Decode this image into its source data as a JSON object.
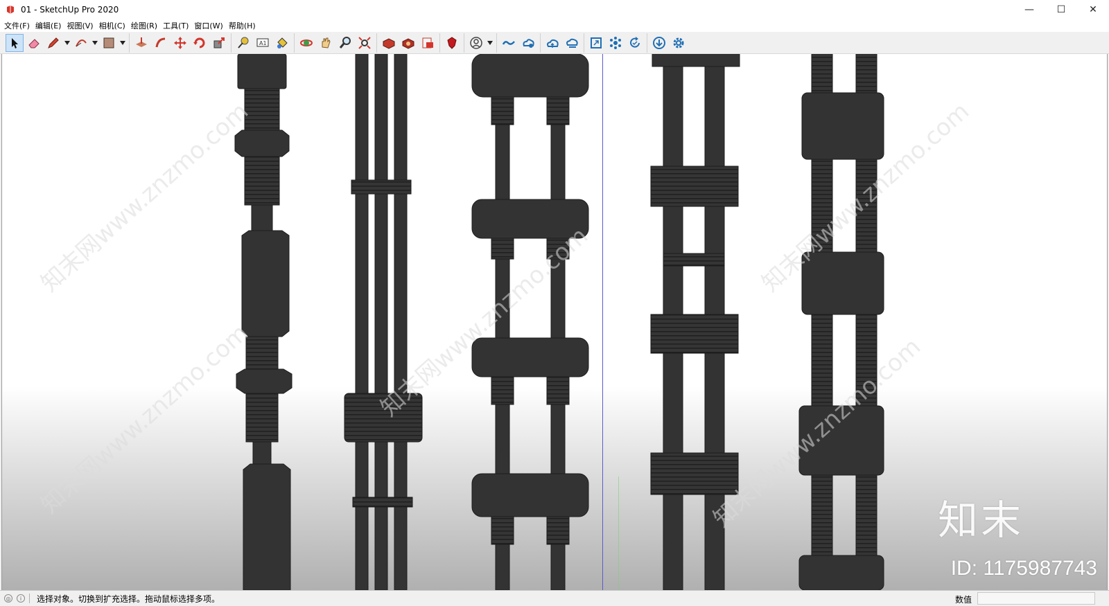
{
  "window": {
    "title": "01 - SketchUp Pro 2020",
    "minimize_glyph": "—",
    "maximize_glyph": "☐",
    "close_glyph": "✕"
  },
  "menu": [
    "文件(F)",
    "编辑(E)",
    "视图(V)",
    "相机(C)",
    "绘图(R)",
    "工具(T)",
    "窗口(W)",
    "帮助(H)"
  ],
  "toolbar": {
    "groups": [
      [
        "select-icon",
        "eraser-icon",
        "pencil-line-icon",
        "arc-icon",
        "rectangle-icon"
      ],
      [
        "push-pull-icon",
        "follow-me-icon",
        "move-icon",
        "rotate-icon",
        "scale-icon"
      ],
      [
        "tape-measure-icon",
        "text-icon",
        "paint-bucket-icon"
      ],
      [
        "orbit-icon",
        "pan-icon",
        "zoom-icon",
        "zoom-extents-icon"
      ],
      [
        "3d-warehouse-icon",
        "extension-warehouse-icon",
        "layout-icon"
      ],
      [
        "ruby-icon"
      ],
      [
        "account-icon"
      ],
      [
        "trimble-connect-icon",
        "trimble-share-icon"
      ],
      [
        "cloud-upload-icon",
        "cloud-sync-icon"
      ],
      [
        "maximize-view-icon",
        "component-icon",
        "refresh-icon"
      ],
      [
        "download-icon",
        "settings-icon"
      ]
    ],
    "active_tool": "select-icon"
  },
  "viewport": {
    "background_top": "#ffffff",
    "background_bottom": "#b0b0b0",
    "model_color": "#333333",
    "axis_blue": "#5a5ad0",
    "watermark_logo": "知末",
    "watermark_id": "ID: 1175987743",
    "watermark_tiles": [
      "知末网www.znzmo.com",
      "知末网www.znzmo.com",
      "知末网www.znzmo.com",
      "知末网www.znzmo.com",
      "知末网www.znzmo.com"
    ]
  },
  "status": {
    "message": "选择对象。切换到扩充选择。拖动鼠标选择多项。",
    "measure_label": "数值",
    "measure_value": ""
  }
}
